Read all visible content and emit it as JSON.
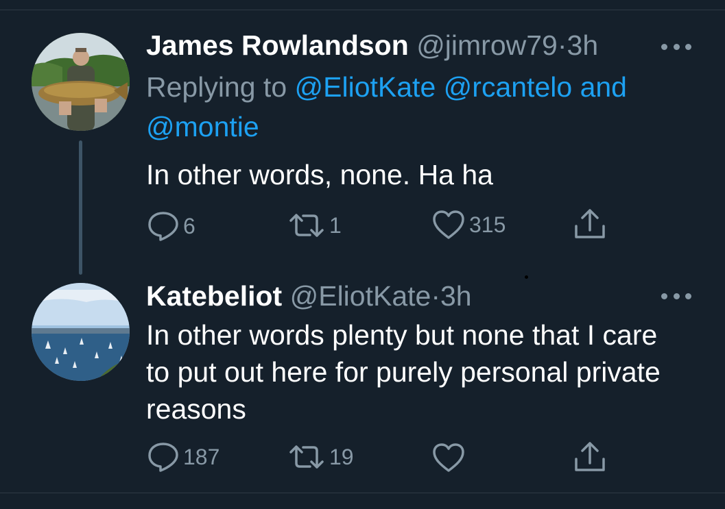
{
  "tweets": [
    {
      "name": "James Rowlandson",
      "handle": "@jimrow79",
      "separator": "·",
      "time": "3h",
      "replying_prefix": "Replying to",
      "replying_mention_1": "@EliotKate",
      "replying_mention_2": "@rcantelo",
      "replying_and": "and",
      "replying_mention_3": "@montie",
      "text": "In other words, none. Ha ha",
      "replies": "6",
      "retweets": "1",
      "likes": "315"
    },
    {
      "name": "Katebeliot",
      "handle": "@EliotKate",
      "separator": "·",
      "time": "3h",
      "text": "In other words plenty but none that I care to put out here for purely personal private reasons",
      "replies": "187",
      "retweets": "19",
      "likes": ""
    }
  ],
  "icons": {
    "reply": "reply-icon",
    "retweet": "retweet-icon",
    "like": "heart-icon",
    "share": "share-icon",
    "more": "more-icon"
  },
  "colors": {
    "background": "#15202b",
    "secondary_text": "#8899a6",
    "link": "#1da1f2",
    "primary_text": "#ffffff"
  }
}
